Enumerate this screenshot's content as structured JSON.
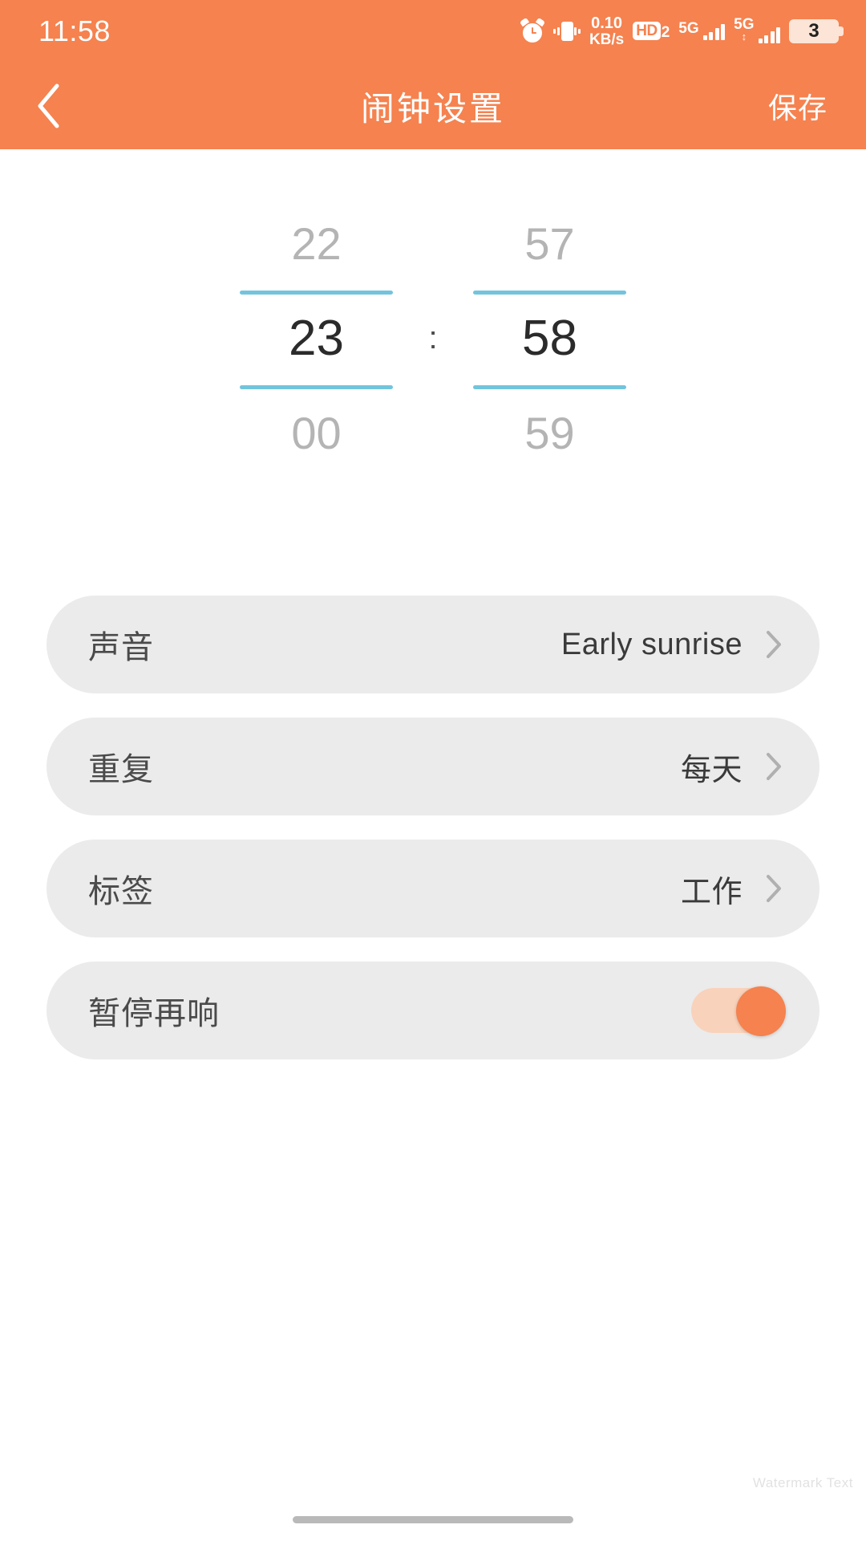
{
  "status_bar": {
    "time": "11:58",
    "network_speed_value": "0.10",
    "network_speed_unit": "KB/s",
    "hd_label": "HD",
    "hd_sub": "2",
    "sim1_network": "5G",
    "sim2_network": "5G",
    "battery_level": "3",
    "icons": [
      "alarm-icon",
      "vibrate-icon",
      "hd-icon",
      "signal-icon",
      "battery-icon"
    ]
  },
  "header": {
    "back_icon": "chevron-left-icon",
    "title": "闹钟设置",
    "save_label": "保存",
    "background_color": "#f5824f"
  },
  "time_picker": {
    "hours": {
      "above": "22",
      "selected": "23",
      "below": "00"
    },
    "minutes": {
      "above": "57",
      "selected": "58",
      "below": "59"
    },
    "separator": ":",
    "rule_color": "#72c4dd",
    "selected_time": "23:58"
  },
  "settings": {
    "rows": [
      {
        "label": "声音",
        "value": "Early sunrise",
        "accessory": "chevron-right-icon"
      },
      {
        "label": "重复",
        "value": "每天",
        "accessory": "chevron-right-icon"
      },
      {
        "label": "标签",
        "value": "工作",
        "accessory": "chevron-right-icon"
      }
    ],
    "snooze": {
      "label": "暂停再响",
      "state": "on",
      "track_color": "#f9d2bb",
      "knob_color": "#f5824f"
    },
    "card_background": "#ebebeb"
  },
  "footer": {
    "watermark": "Watermark Text"
  }
}
